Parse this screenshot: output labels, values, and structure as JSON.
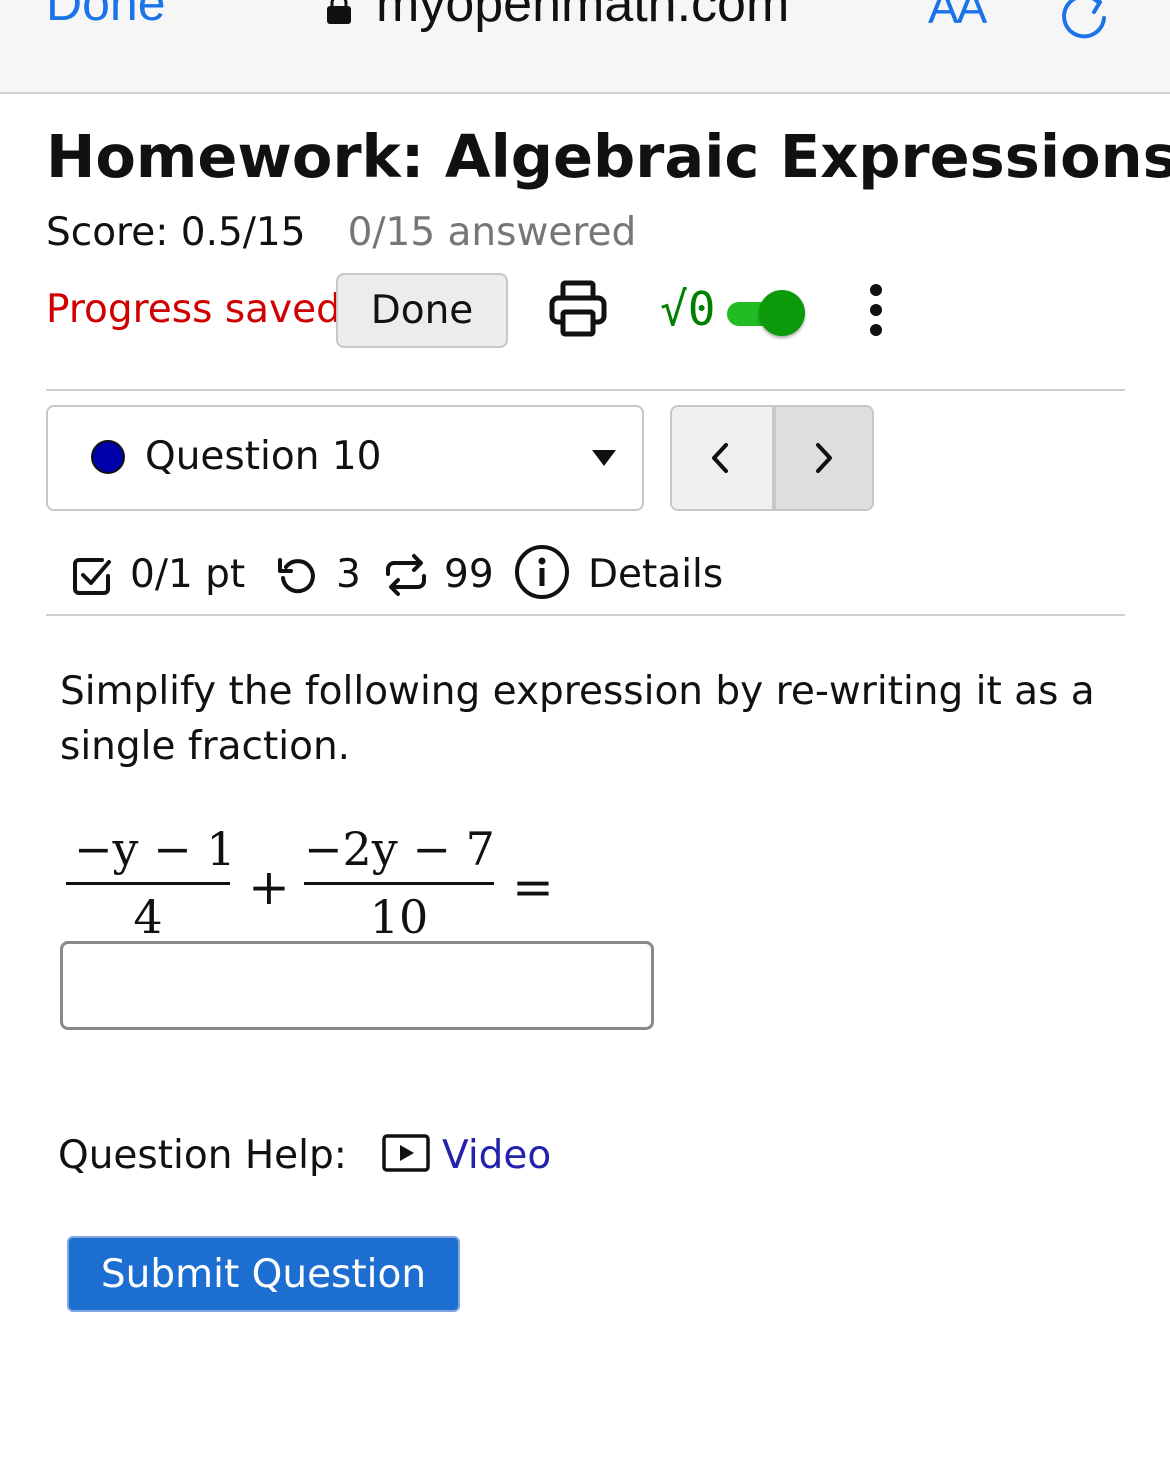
{
  "browser": {
    "done_label": "Done",
    "url": "myopenmath.com",
    "text_size_label": "AA",
    "lock_icon": "lock-icon",
    "reload_icon": "reload-icon"
  },
  "header": {
    "title": "Homework: Algebraic Expressions",
    "score": "Score: 0.5/15",
    "answered": "0/15 answered"
  },
  "toolbar": {
    "progress_status": "Progress saved",
    "done_button": "Done",
    "print_icon": "print-icon",
    "math_toggle_label": "√0",
    "math_toggle_on": true,
    "more_icon": "more-vertical-icon"
  },
  "question_nav": {
    "selected": "Question 10",
    "status_color": "#0000aa",
    "prev_icon": "chevron-left-icon",
    "next_icon": "chevron-right-icon"
  },
  "question_meta": {
    "points": "0/1 pt",
    "retries": "3",
    "versions": "99",
    "details": "Details"
  },
  "question": {
    "prompt": "Simplify the following expression by re-writing it as a single fraction.",
    "term1_numerator": "−y − 1",
    "term1_denominator": "4",
    "operator": "+",
    "term2_numerator": "−2y − 7",
    "term2_denominator": "10",
    "equals": "=",
    "answer_value": ""
  },
  "help": {
    "label": "Question Help:",
    "video": "Video"
  },
  "submit": {
    "label": "Submit Question"
  },
  "colors": {
    "link": "#1a73e8",
    "error": "#d00000",
    "toggle": "#0a9a0a",
    "submit": "#1c6fd1"
  }
}
